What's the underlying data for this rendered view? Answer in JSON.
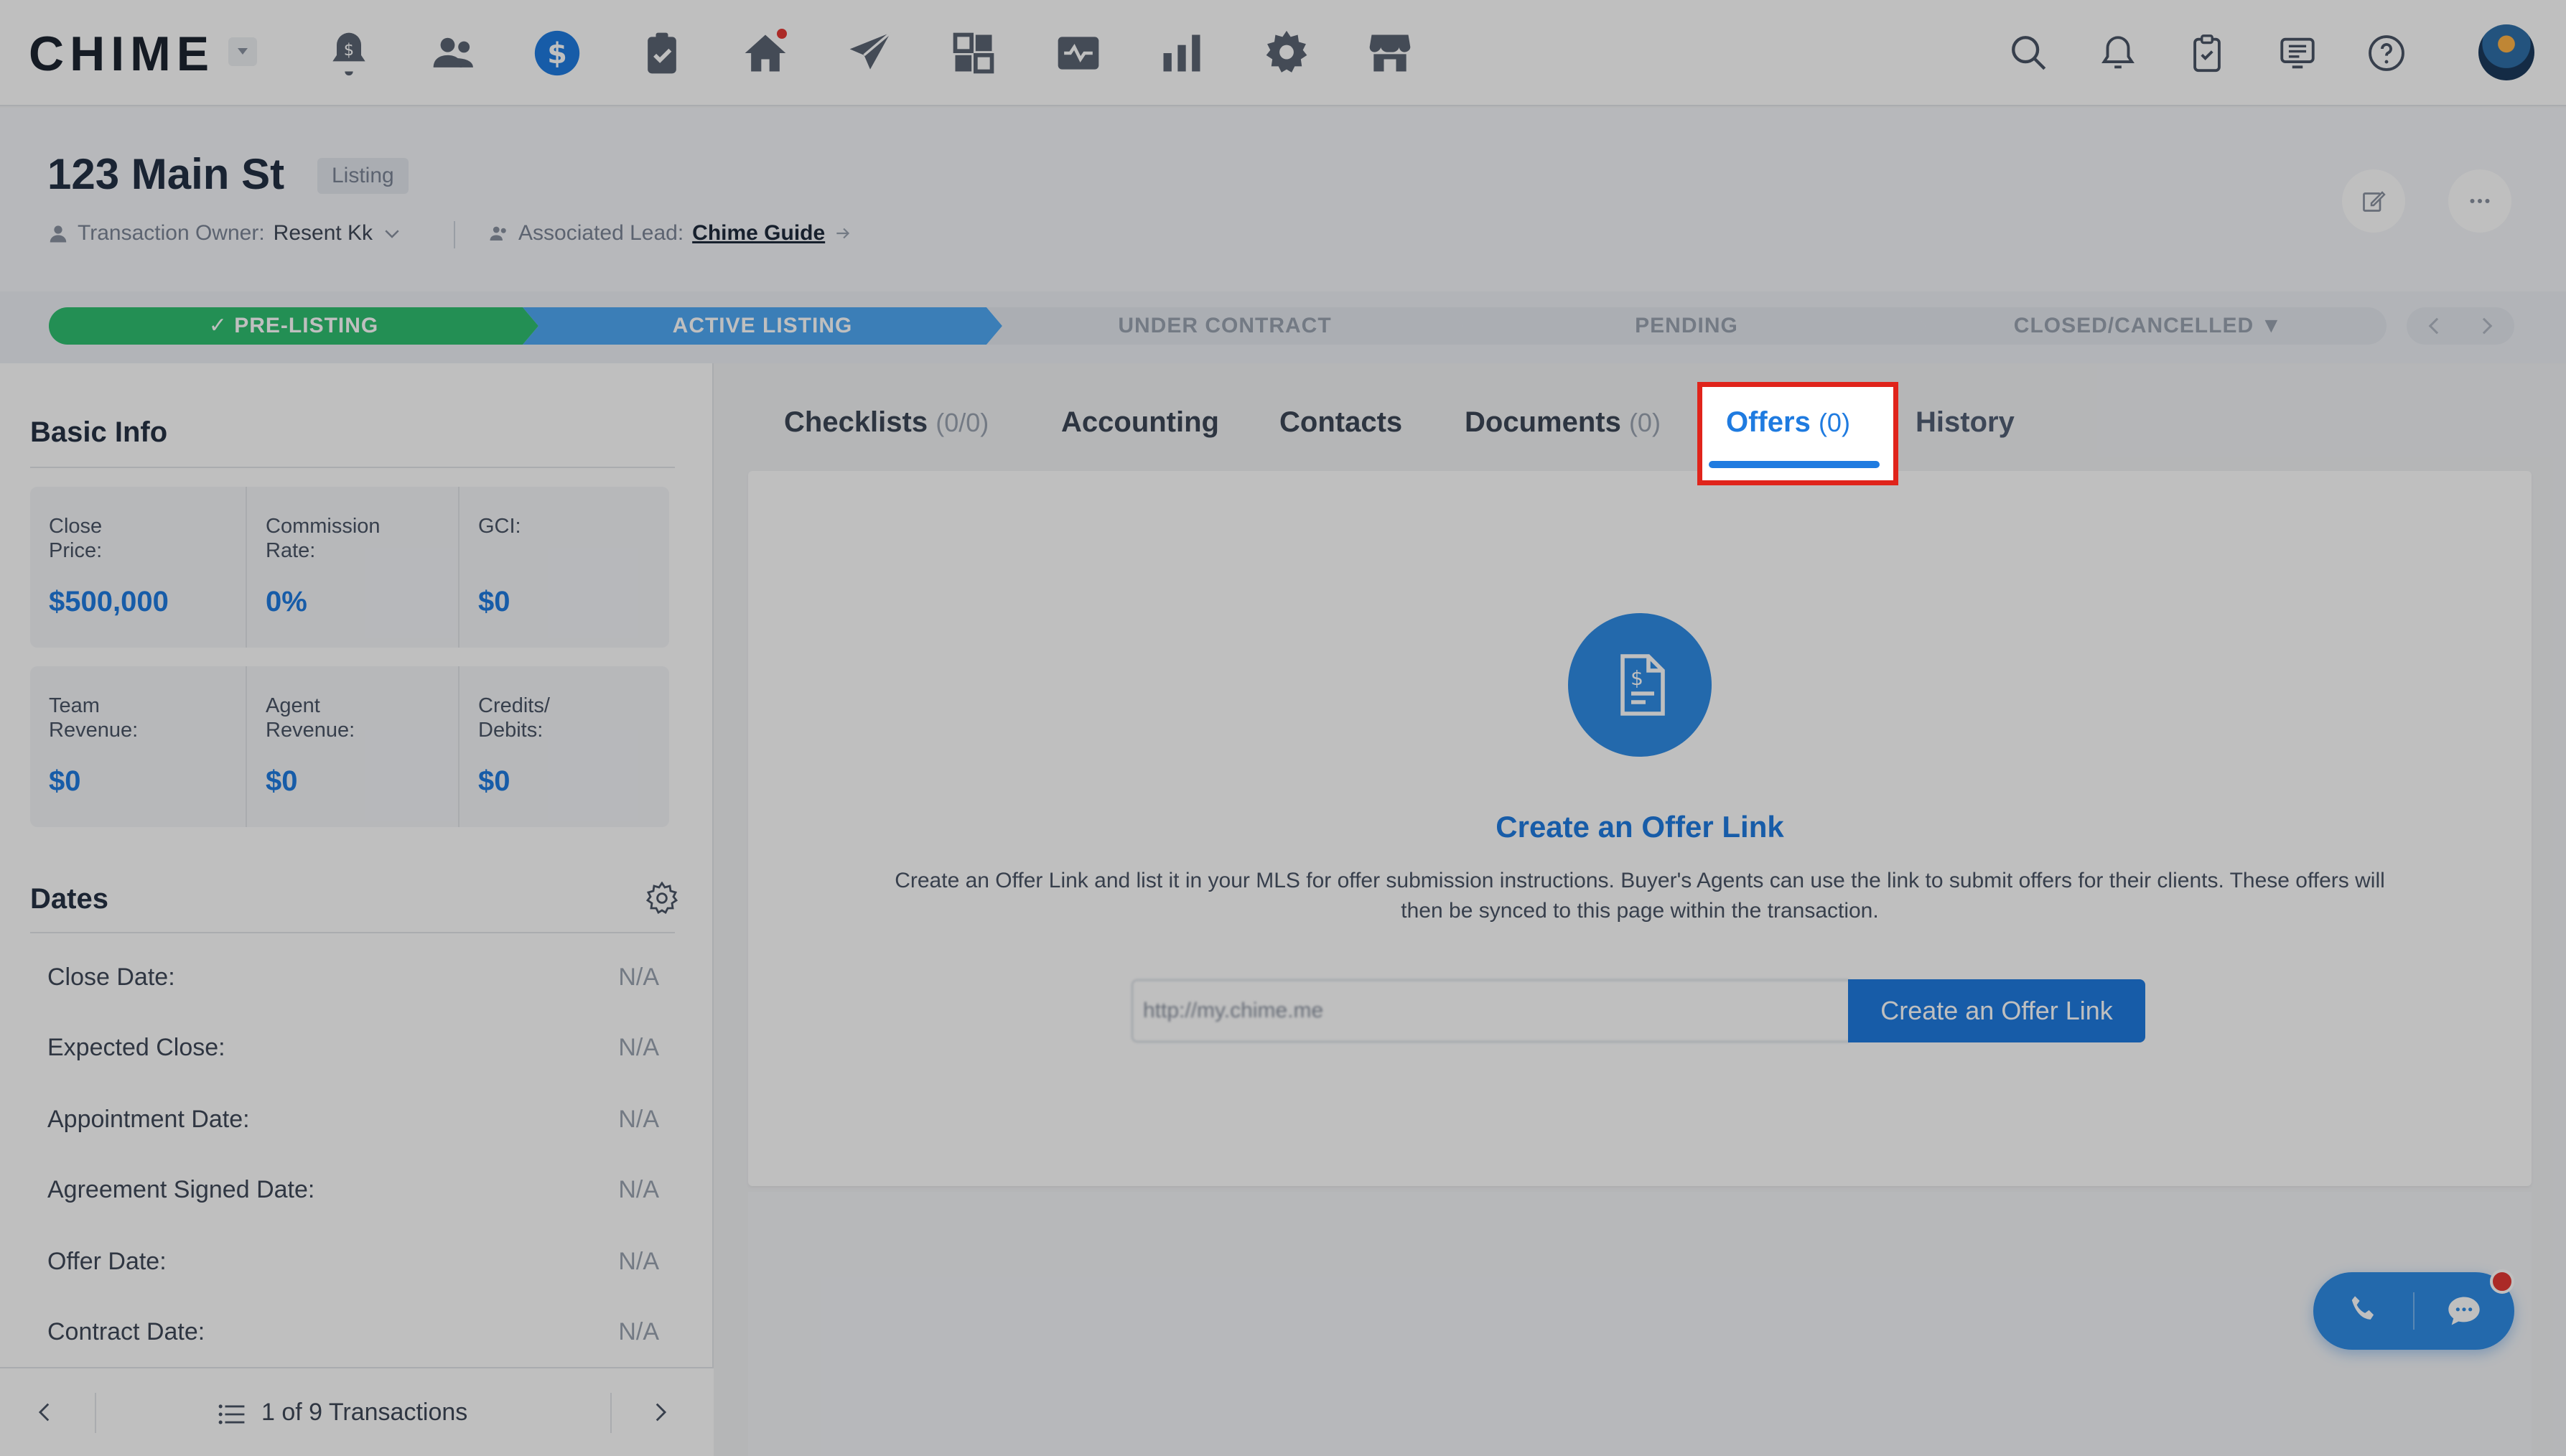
{
  "app": {
    "logo": "CHIME"
  },
  "nav": {
    "icons": [
      "alerts-dollar-icon",
      "people-icon",
      "dollar-icon",
      "clipboard-check-icon",
      "home-icon",
      "send-icon",
      "dashboard-grid-icon",
      "activity-icon",
      "bar-chart-icon",
      "gear-icon",
      "marketplace-icon"
    ],
    "active": "dollar-icon",
    "right_icons": [
      "search-icon",
      "bell-icon",
      "clipboard-icon",
      "chat-screen-icon",
      "help-icon"
    ]
  },
  "header": {
    "title": "123 Main St",
    "badge": "Listing",
    "owner_label": "Transaction Owner:",
    "owner_value": "Resent Kk",
    "lead_label": "Associated Lead:",
    "lead_value": "Chime Guide"
  },
  "pipeline": {
    "stages": [
      {
        "label": "PRE-LISTING",
        "state": "done"
      },
      {
        "label": "ACTIVE LISTING",
        "state": "active"
      },
      {
        "label": "UNDER CONTRACT",
        "state": "todo"
      },
      {
        "label": "PENDING",
        "state": "todo"
      },
      {
        "label": "CLOSED/CANCELLED",
        "state": "todo"
      }
    ]
  },
  "basic_info": {
    "title": "Basic Info",
    "row1": [
      {
        "label": "Close\nPrice:",
        "value": "$500,000"
      },
      {
        "label": "Commission\nRate:",
        "value": "0%"
      },
      {
        "label": "GCI:",
        "value": "$0"
      }
    ],
    "row2": [
      {
        "label": "Team\nRevenue:",
        "value": "$0"
      },
      {
        "label": "Agent\nRevenue:",
        "value": "$0"
      },
      {
        "label": "Credits/\nDebits:",
        "value": "$0"
      }
    ]
  },
  "dates": {
    "title": "Dates",
    "rows": [
      {
        "label": "Close Date:",
        "value": "N/A"
      },
      {
        "label": "Expected Close:",
        "value": "N/A"
      },
      {
        "label": "Appointment Date:",
        "value": "N/A"
      },
      {
        "label": "Agreement Signed Date:",
        "value": "N/A"
      },
      {
        "label": "Offer Date:",
        "value": "N/A"
      },
      {
        "label": "Contract Date:",
        "value": "N/A"
      }
    ]
  },
  "pager": {
    "text": "1 of 9 Transactions"
  },
  "tabs": [
    {
      "label": "Checklists",
      "count": "(0/0)"
    },
    {
      "label": "Accounting",
      "count": ""
    },
    {
      "label": "Contacts",
      "count": ""
    },
    {
      "label": "Documents",
      "count": "(0)"
    },
    {
      "label": "Offers",
      "count": "(0)"
    },
    {
      "label": "History",
      "count": ""
    }
  ],
  "offers": {
    "title": "Create an Offer Link",
    "description": "Create an Offer Link and list it in your MLS for offer submission instructions. Buyer's Agents can use the link to submit offers for their clients. These offers will then be synced to this page within the transaction.",
    "input_value": "http://my.chime.me",
    "button_label": "Create an Offer Link"
  },
  "colors": {
    "accent": "#1f7be0",
    "done": "#2fbf71",
    "active_stage": "#4fa8f4",
    "highlight": "#e0241b"
  }
}
